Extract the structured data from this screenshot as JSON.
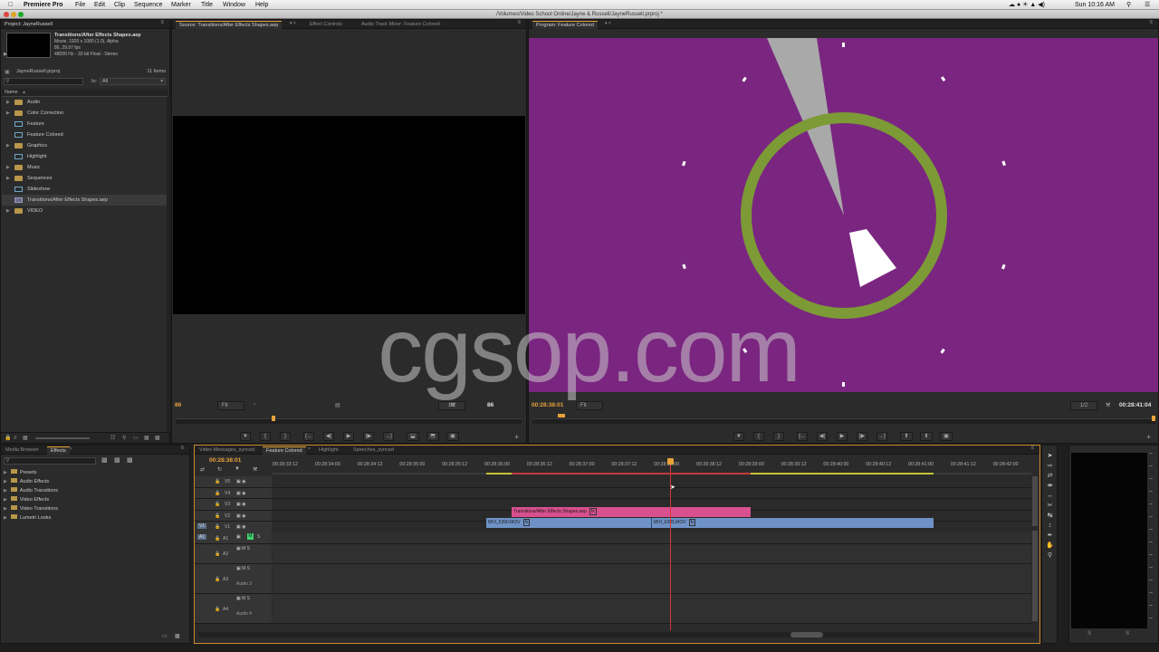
{
  "menubar": {
    "apple_icon": "apple-icon",
    "app_name": "Premiere Pro",
    "items": [
      "File",
      "Edit",
      "Clip",
      "Sequence",
      "Marker",
      "Title",
      "Window",
      "Help"
    ],
    "clock": "Sun 10:16 AM"
  },
  "window": {
    "path": "/Volumes/Video School Online/Jayne & Russell/JayneRussell.prproj *"
  },
  "project": {
    "tab": "Project: JayneRussell",
    "clip_name": "Transitions/After Effects Shapes.aep",
    "clip_info_1": "Movie, 1920 x 1080 (1.0), Alpha",
    "clip_info_2": "86, 29.97 fps",
    "clip_info_3": "48000 Hz - 32-bit Float - Stereo",
    "project_file": "JayneRussell.prproj",
    "item_count": "11 Items",
    "search_placeholder": "",
    "in_label": "In:",
    "in_value": "All",
    "column_name": "Name",
    "bins": [
      {
        "label": "Audio",
        "type": "folder"
      },
      {
        "label": "Color Correction",
        "type": "folder"
      },
      {
        "label": "Feature",
        "type": "sequence"
      },
      {
        "label": "Feature Colored",
        "type": "sequence"
      },
      {
        "label": "Graphics",
        "type": "folder"
      },
      {
        "label": "Highlight",
        "type": "sequence"
      },
      {
        "label": "Music",
        "type": "folder"
      },
      {
        "label": "Sequences",
        "type": "folder"
      },
      {
        "label": "Slideshow",
        "type": "sequence"
      },
      {
        "label": "Transitions/After Effects Shapes.aep",
        "type": "aep"
      },
      {
        "label": "VIDEO",
        "type": "folder"
      }
    ]
  },
  "source": {
    "tabs": [
      "Source: Transitions/After Effects Shapes.aep",
      "Effect Controls",
      "Audio Track Mixer: Feature Colored"
    ],
    "timecode_in": "86",
    "fit": "Fit",
    "resolution": "1/2",
    "duration": "86"
  },
  "program": {
    "tab": "Program: Feature Colored",
    "timecode": "00:28:38:01",
    "fit": "Fit",
    "resolution": "1/2",
    "duration": "00:28:41:04",
    "bg_color": "#7a2680",
    "ring_color": "#7c9a36"
  },
  "effects": {
    "tabs": [
      "Media Browser",
      "Effects"
    ],
    "items": [
      "Presets",
      "Audio Effects",
      "Audio Transitions",
      "Video Effects",
      "Video Transitions",
      "Lumetri Looks"
    ]
  },
  "timeline": {
    "tabs": [
      "Video Messages_synced",
      "Feature Colored",
      "Highlight",
      "Speeches_synced"
    ],
    "timecode": "00:28:38:01",
    "ruler": [
      "00:28:33:12",
      "00:28:34:00",
      "00:28:34:12",
      "00:28:35:00",
      "00:28:35:12",
      "00:28:36:00",
      "00:28:36:12",
      "00:28:37:00",
      "00:28:37:12",
      "00:28:38:00",
      "00:28:38:12",
      "00:28:39:00",
      "00:28:39:12",
      "00:28:40:00",
      "00:28:40:12",
      "00:28:41:00",
      "00:28:41:12",
      "00:28:42:00"
    ],
    "video_tracks": [
      "V5",
      "V4",
      "V3",
      "V2",
      "V1"
    ],
    "audio_tracks": [
      "A1",
      "A2",
      "A3",
      "A4"
    ],
    "audio_names": [
      "",
      "",
      "Audio 3",
      "Audio 4"
    ],
    "src_v": "V1",
    "src_a": "A1",
    "clips": {
      "aep": "Transitions/After Effects Shapes.aep",
      "mov1": "MVI_6390.MOV",
      "mov2": "MVI_6395.MOV"
    },
    "clip_colors": {
      "aep": "#d8508e",
      "mov": "#6f92c6"
    }
  },
  "watermark": "cgsop.com"
}
